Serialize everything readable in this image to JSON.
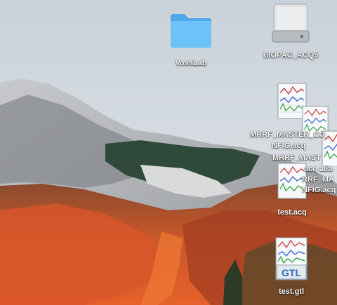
{
  "desktop": {
    "icons": [
      {
        "label": "VossLab",
        "icon": "folder-icon"
      },
      {
        "label": "BIOPAC_ACQ5",
        "icon": "hard-drive-icon"
      },
      {
        "label": "MRRF_MASTER_CO_",
        "icon": "acq-file-icon"
      },
      {
        "label": "NFIG.acq",
        "icon": "acq-file-icon"
      },
      {
        "label": "MRRF_MAST",
        "icon": "acq-file-icon"
      },
      {
        "label": "acq alia",
        "icon": "acq-file-icon"
      },
      {
        "label": "RRF_MA",
        "icon": "acq-file-icon"
      },
      {
        "label": "NFIG.acq",
        "icon": "acq-file-icon"
      },
      {
        "label": "test.acq",
        "icon": "acq-file-icon"
      },
      {
        "label": "test.gtl",
        "icon": "gtl-file-icon"
      },
      {
        "badge": "GTL"
      }
    ]
  },
  "colors": {
    "folder": "#62bdf5",
    "label": "#ffffff"
  }
}
